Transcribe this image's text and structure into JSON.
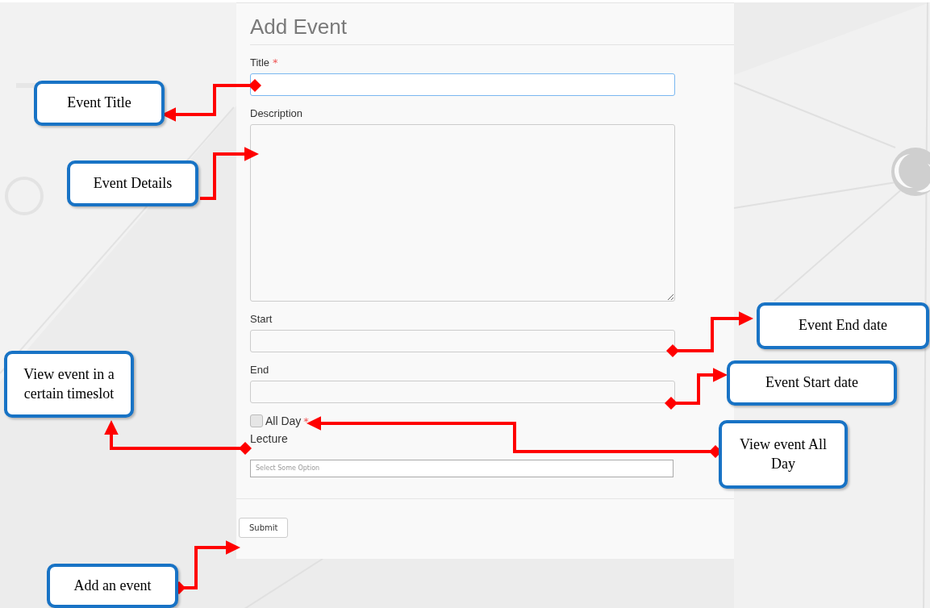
{
  "form": {
    "title": "Add Event",
    "fields": [
      {
        "kind": "text",
        "label": "Title",
        "required_mark": "*",
        "focused": true
      },
      {
        "kind": "textarea",
        "label": "Description"
      },
      {
        "kind": "text",
        "label": "Start"
      },
      {
        "kind": "text",
        "label": "End"
      },
      {
        "kind": "checkbox",
        "label": "All Day",
        "required_mark": "*",
        "checked": false
      },
      {
        "kind": "select",
        "label": "Lecture",
        "placeholder": "Select Some Option"
      }
    ],
    "submit": "Submit"
  },
  "annotations": [
    {
      "text": "Event Title"
    },
    {
      "text": "Event Details"
    },
    {
      "text": "Event End date"
    },
    {
      "text": "Event Start date"
    },
    {
      "text": "View event in a certain timeslot"
    },
    {
      "text": "View event  All Day"
    },
    {
      "text": "Add an event"
    }
  ]
}
